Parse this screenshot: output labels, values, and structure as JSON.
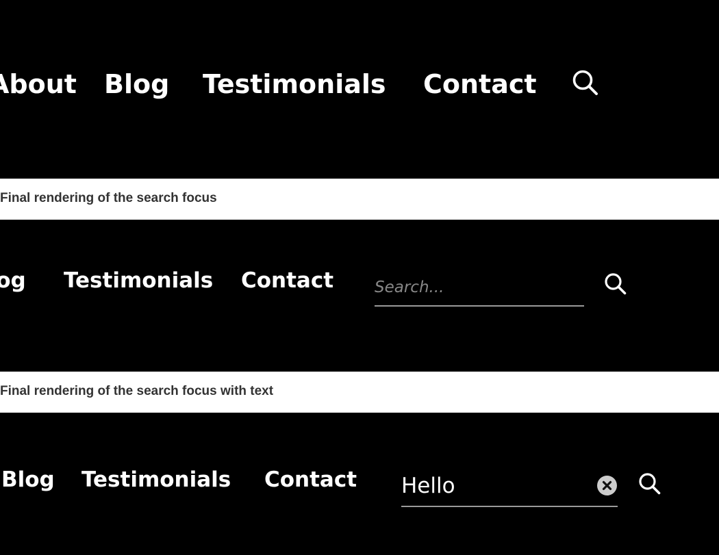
{
  "panel_default": {
    "nav": [
      "About",
      "Blog",
      "Testimonials",
      "Contact"
    ],
    "search_icon": "search-icon"
  },
  "caption_focus": "Final rendering of the search focus",
  "panel_focus": {
    "nav": [
      "Blog",
      "Testimonials",
      "Contact"
    ],
    "search_placeholder": "Search...",
    "search_icon": "search-icon"
  },
  "caption_focus_text": "Final rendering of the search focus with text",
  "panel_focus_text": {
    "nav": [
      "Blog",
      "Testimonials",
      "Contact"
    ],
    "search_value": "Hello",
    "clear_icon": "clear-circle-x-icon",
    "search_icon": "search-icon"
  },
  "colors": {
    "panel_bg": "#000000",
    "nav_text": "#ffffff",
    "caption_text": "#333333",
    "underline": "#9a9a9a",
    "placeholder": "#888888",
    "clear_button": "#cccccc"
  }
}
